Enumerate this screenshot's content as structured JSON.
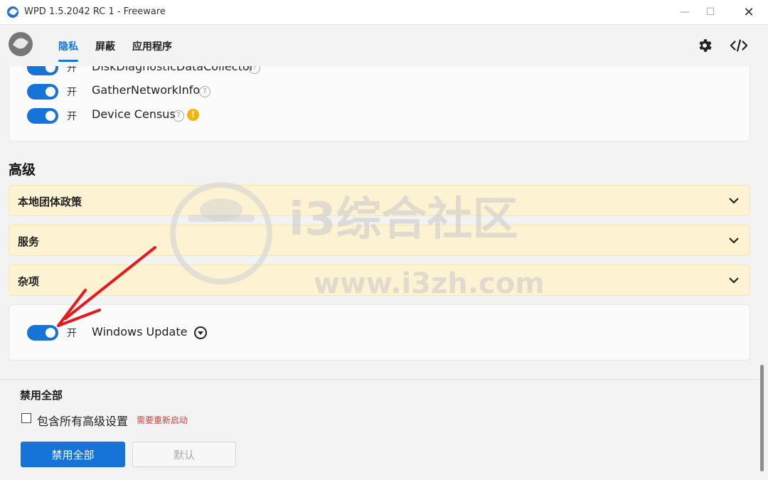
{
  "window": {
    "title": "WPD 1.5.2042 RC 1 - Freeware"
  },
  "nav": {
    "tabs": [
      {
        "label": "隐私"
      },
      {
        "label": "屏蔽"
      },
      {
        "label": "应用程序"
      }
    ]
  },
  "top_icons": [
    "gear-icon",
    "code-icon"
  ],
  "privacy_items": [
    {
      "state": "开",
      "name": "DiskDiagnosticDataCollector"
    },
    {
      "state": "开",
      "name": "GatherNetworkInfo"
    },
    {
      "state": "开",
      "name": "Device Census"
    }
  ],
  "advanced": {
    "title": "高级",
    "accordions": [
      {
        "label": "本地团体政策"
      },
      {
        "label": "服务"
      },
      {
        "label": "杂项"
      }
    ],
    "misc_item": {
      "state": "开",
      "name": "Windows Update"
    }
  },
  "footer": {
    "title": "禁用全部",
    "checkbox_label": "包含所有高级设置",
    "restart_note": "需要重新启动",
    "disable_all_button": "禁用全部",
    "default_button": "默认"
  },
  "watermark": {
    "main": "i3综合社区",
    "url": "www.i3zh.com"
  },
  "colors": {
    "accent": "#1673d8",
    "accordion_bg": "#fdf3d2",
    "warning": "#f2b400",
    "note_red": "#e03a3a",
    "annotation_arrow": "#e8191c"
  }
}
